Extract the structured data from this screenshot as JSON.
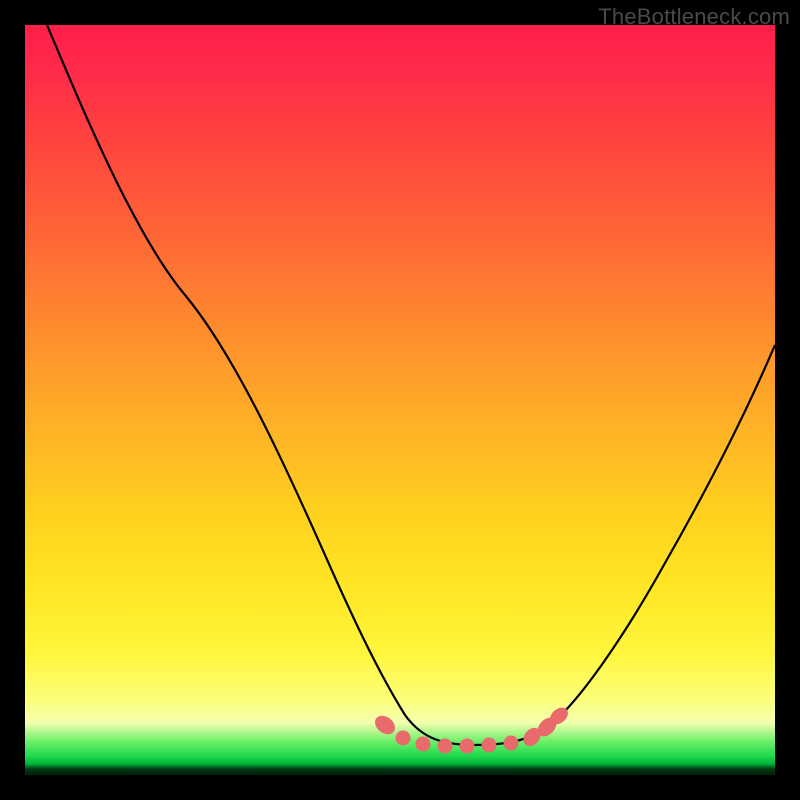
{
  "watermark": "TheBottleneck.com",
  "colors": {
    "background": "#000000",
    "curve_stroke": "#000000",
    "marker_fill": "#e96a6a",
    "marker_stroke": "#d24f4f",
    "gradient_top": "#ff1f4a",
    "gradient_mid": "#ffd31e",
    "gradient_green": "#1fd84e"
  },
  "chart_data": {
    "type": "line",
    "title": "",
    "xlabel": "",
    "ylabel": "",
    "xlim": [
      0,
      100
    ],
    "ylim": [
      0,
      100
    ],
    "grid": false,
    "legend": false,
    "series": [
      {
        "name": "curve",
        "x": [
          3,
          10,
          20,
          30,
          38,
          44,
          49,
          53,
          58,
          64,
          68,
          71,
          76,
          82,
          88,
          94,
          100
        ],
        "y": [
          100,
          85,
          66,
          48,
          33,
          22,
          13,
          7,
          4,
          4,
          5,
          7,
          13,
          23,
          36,
          49,
          60
        ]
      }
    ],
    "markers": {
      "x": [
        47,
        49.5,
        52,
        55,
        58,
        61,
        64,
        67,
        69,
        70.5
      ],
      "y": [
        9.5,
        7,
        5.5,
        4.6,
        4.3,
        4.3,
        4.5,
        5.2,
        6.3,
        7.5
      ]
    },
    "gradient_scale": {
      "0": "red",
      "50": "yellow",
      "95": "green"
    }
  }
}
